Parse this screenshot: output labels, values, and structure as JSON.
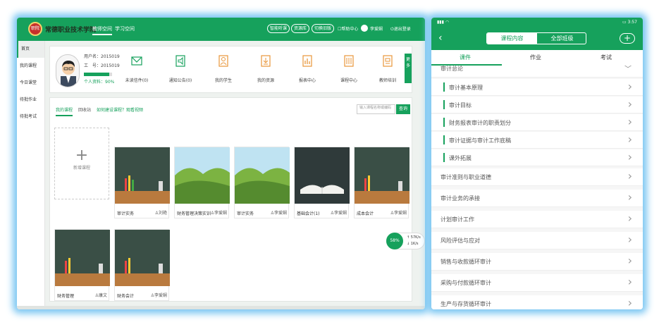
{
  "web": {
    "school_name": "常德职业技术学院",
    "logo_text": "职院",
    "nav_tabs": [
      "教师空间",
      "学习空间"
    ],
    "top_buttons": [
      "智能听课",
      "资源库",
      "切换旧版"
    ],
    "help": "☐帮助中心",
    "user_name": "李爱娴",
    "logout": "⏻退出登录",
    "sidebar": [
      "首页",
      "我的课程",
      "今日课堂",
      "待批作业",
      "待批考试"
    ],
    "profile": {
      "username": "用户名：2015019",
      "worker_id": "工　号：2015019",
      "progress_percent": 90,
      "progress_text": "个人资料：90%"
    },
    "quick_links": [
      "未读信件(0)",
      "通知公告(0)",
      "我的学生",
      "我的资源",
      "报表中心",
      "课程中心",
      "教师培训"
    ],
    "more": "更多",
    "course_tabs": {
      "mine": "我的课程",
      "recycle": "回收站",
      "help": "如何建设课程？观看视频"
    },
    "search_placeholder": "输入课程名称或编码",
    "search_button": "查询",
    "new_course": "新增课程",
    "courses": [
      {
        "name": "审计实务",
        "teacher": "刘艳"
      },
      {
        "name": "财务管理决策实训",
        "teacher": "李爱娴"
      },
      {
        "name": "审计实务",
        "teacher": "李爱娴"
      },
      {
        "name": "基础会计(1)",
        "teacher": "李爱娴"
      },
      {
        "name": "成本会计",
        "teacher": "李爱娴"
      },
      {
        "name": "财务管理",
        "teacher": "康文"
      },
      {
        "name": "财务会计",
        "teacher": "李爱娴"
      }
    ],
    "speed": {
      "percent": "58%",
      "up": "↑ 57K/s",
      "down": "↓ 1K/s"
    }
  },
  "mobile": {
    "status_time": "3:57",
    "header_tabs": [
      "课程内容",
      "全部班级"
    ],
    "tabs": [
      "课件",
      "作业",
      "考试"
    ],
    "list": [
      {
        "title": "审计总论",
        "type": "section",
        "expanded": true
      },
      {
        "title": "审计基本原理",
        "type": "sub"
      },
      {
        "title": "审计目标",
        "type": "sub"
      },
      {
        "title": "财务报表审计的职责划分",
        "type": "sub"
      },
      {
        "title": "审计证据与审计工作底稿",
        "type": "sub"
      },
      {
        "title": "课外拓展",
        "type": "sub"
      },
      {
        "title": "审计准则与职业道德",
        "type": "section"
      },
      {
        "title": "审计业务的承接",
        "type": "section"
      },
      {
        "title": "计划审计工作",
        "type": "section"
      },
      {
        "title": "风险评估与应对",
        "type": "section"
      },
      {
        "title": "销售与收款循环审计",
        "type": "section"
      },
      {
        "title": "采购与付款循环审计",
        "type": "section"
      },
      {
        "title": "生产与存货循环审计",
        "type": "section"
      }
    ]
  },
  "colors": {
    "brand_green": "#16a15c",
    "glow": "#7cc7f2"
  }
}
